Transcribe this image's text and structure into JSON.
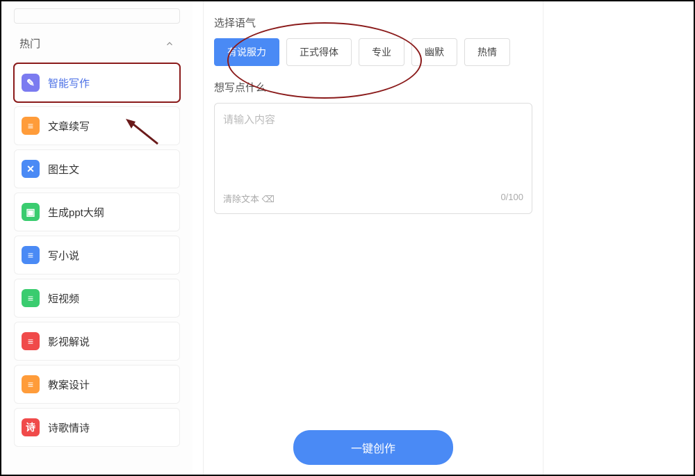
{
  "sidebar": {
    "category_label": "热门",
    "items": [
      {
        "label": "智能写作",
        "icon": "doc-pen-icon",
        "color": "purple",
        "active": true,
        "highlighted": true
      },
      {
        "label": "文章续写",
        "icon": "doc-icon",
        "color": "orange"
      },
      {
        "label": "图生文",
        "icon": "image-icon",
        "color": "blue"
      },
      {
        "label": "生成ppt大纲",
        "icon": "slide-icon",
        "color": "green"
      },
      {
        "label": "写小说",
        "icon": "doc-icon",
        "color": "blue"
      },
      {
        "label": "短视频",
        "icon": "doc-icon",
        "color": "green2"
      },
      {
        "label": "影视解说",
        "icon": "doc-icon",
        "color": "red"
      },
      {
        "label": "教案设计",
        "icon": "doc-icon",
        "color": "orange2"
      },
      {
        "label": "诗歌情诗",
        "icon": "poem-icon",
        "color": "red2"
      }
    ]
  },
  "main": {
    "tone_label": "选择语气",
    "tones": [
      {
        "label": "有说服力",
        "selected": true
      },
      {
        "label": "正式得体",
        "selected": false
      },
      {
        "label": "专业",
        "selected": false
      },
      {
        "label": "幽默",
        "selected": false
      },
      {
        "label": "热情",
        "selected": false
      }
    ],
    "content_label": "想写点什么",
    "editor_placeholder": "请输入内容",
    "clear_label": "清除文本 ⌫",
    "counter": "0/100",
    "submit_label": "一键创作"
  },
  "icon_glyphs": {
    "doc-pen-icon": "✎",
    "doc-icon": "≡",
    "image-icon": "✕",
    "slide-icon": "▣",
    "poem-icon": "诗"
  }
}
